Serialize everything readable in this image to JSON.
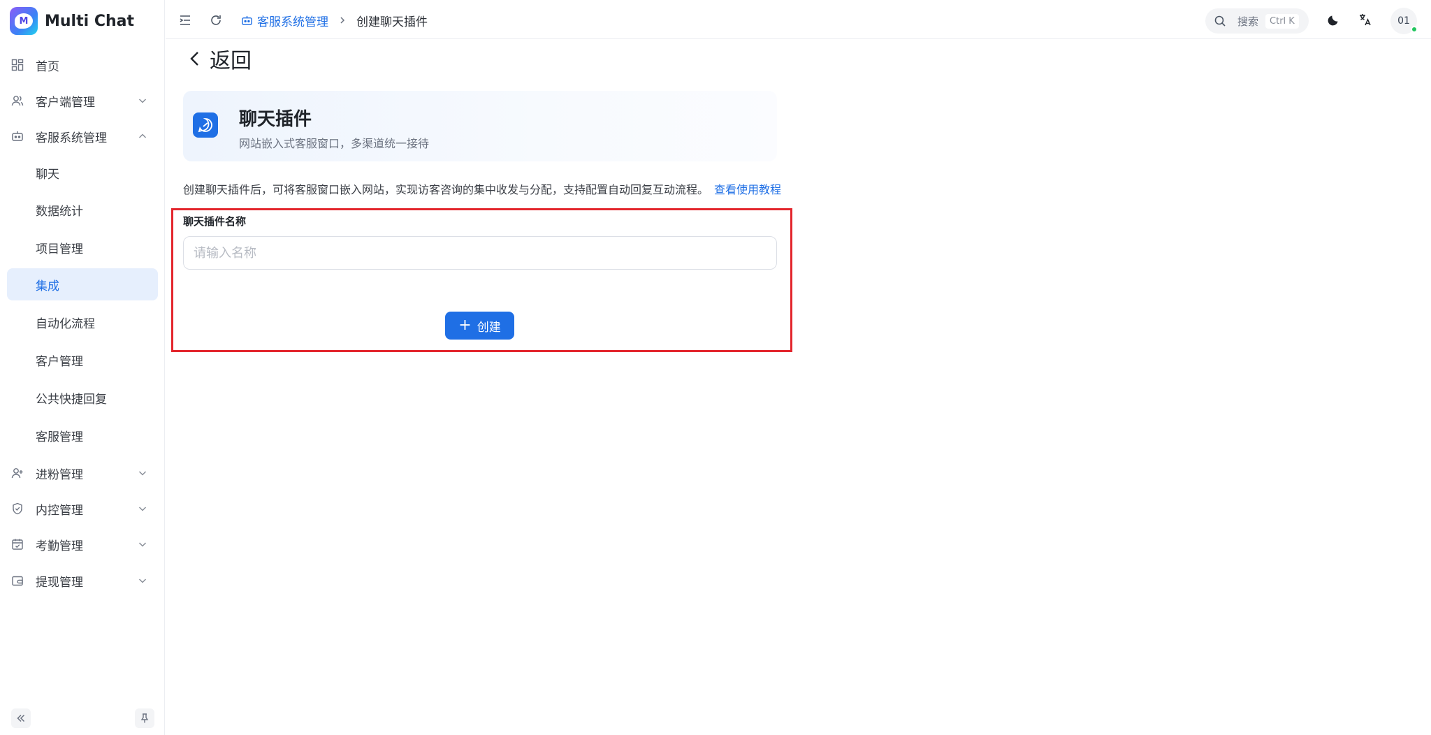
{
  "app": {
    "name": "Multi Chat",
    "logo_letter": "M"
  },
  "sidebar": {
    "items": [
      {
        "label": "首页",
        "icon": "dashboard-icon"
      },
      {
        "label": "客户端管理",
        "icon": "users-icon",
        "expandable": true
      },
      {
        "label": "客服系统管理",
        "icon": "robot-icon",
        "expandable": true,
        "expanded": true
      },
      {
        "label": "聊天",
        "sub": true
      },
      {
        "label": "数据统计",
        "sub": true
      },
      {
        "label": "项目管理",
        "sub": true
      },
      {
        "label": "集成",
        "sub": true,
        "active": true
      },
      {
        "label": "自动化流程",
        "sub": true
      },
      {
        "label": "客户管理",
        "sub": true
      },
      {
        "label": "公共快捷回复",
        "sub": true
      },
      {
        "label": "客服管理",
        "sub": true
      },
      {
        "label": "进粉管理",
        "icon": "user-plus-icon",
        "expandable": true
      },
      {
        "label": "内控管理",
        "icon": "shield-icon",
        "expandable": true
      },
      {
        "label": "考勤管理",
        "icon": "calendar-icon",
        "expandable": true
      },
      {
        "label": "提现管理",
        "icon": "wallet-icon",
        "expandable": true
      }
    ]
  },
  "header": {
    "breadcrumb": {
      "parent": "客服系统管理",
      "current": "创建聊天插件"
    },
    "search": {
      "label": "搜索",
      "shortcut": "Ctrl K"
    },
    "avatar": "01"
  },
  "main": {
    "back_label": "返回",
    "card": {
      "title": "聊天插件",
      "desc": "网站嵌入式客服窗口，多渠道统一接待"
    },
    "intro": {
      "text": "创建聊天插件后，可将客服窗口嵌入网站，实现访客咨询的集中收发与分配，支持配置自动回复互动流程。",
      "link": "查看使用教程"
    },
    "form": {
      "label": "聊天插件名称",
      "placeholder": "请输入名称",
      "value": "",
      "submit": "创建"
    }
  },
  "colors": {
    "accent": "#1f6fe5",
    "highlight": "#e3262d",
    "active_bg": "#e6effd"
  }
}
